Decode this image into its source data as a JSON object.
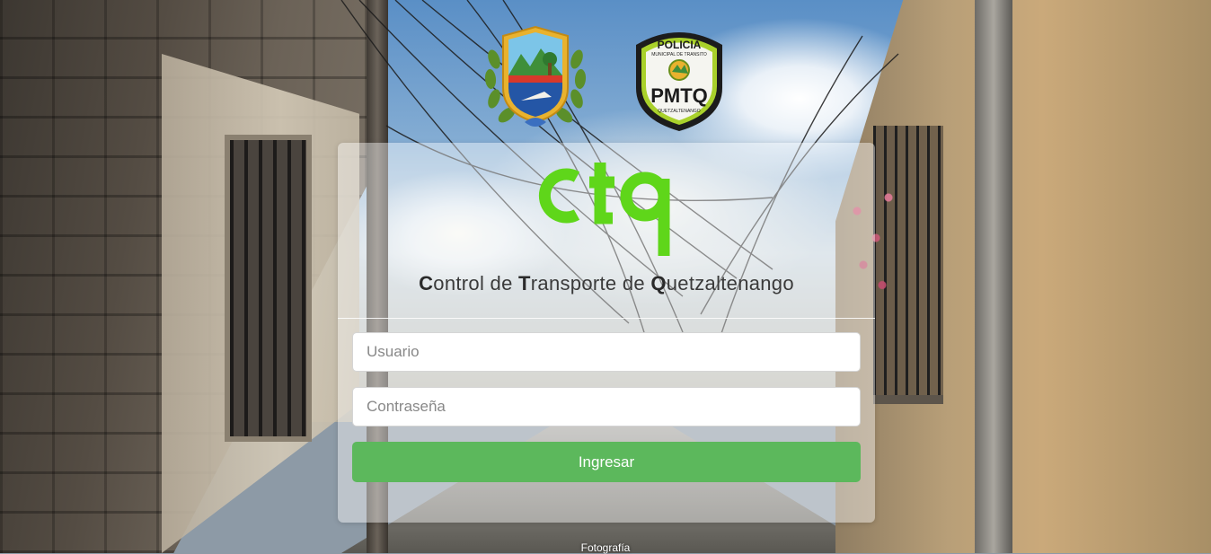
{
  "login": {
    "title_parts": [
      {
        "initial": "C",
        "rest": "ontrol de "
      },
      {
        "initial": "T",
        "rest": "ransporte de "
      },
      {
        "initial": "Q",
        "rest": "uetzaltenango"
      }
    ],
    "username_placeholder": "Usuario",
    "password_placeholder": "Contraseña",
    "submit_label": "Ingresar"
  },
  "logos": {
    "brand": "ctq",
    "police_top": "POLICIA",
    "police_sub": "MUNICIPAL DE TRANSITO",
    "police_main": "PMTQ",
    "police_bottom": "QUETZALTENANGO"
  },
  "footer": {
    "photo_credit": "Fotografía"
  },
  "colors": {
    "brand_green": "#5fd61a",
    "button_green": "#5cb85c",
    "police_green": "#a9d12b"
  }
}
